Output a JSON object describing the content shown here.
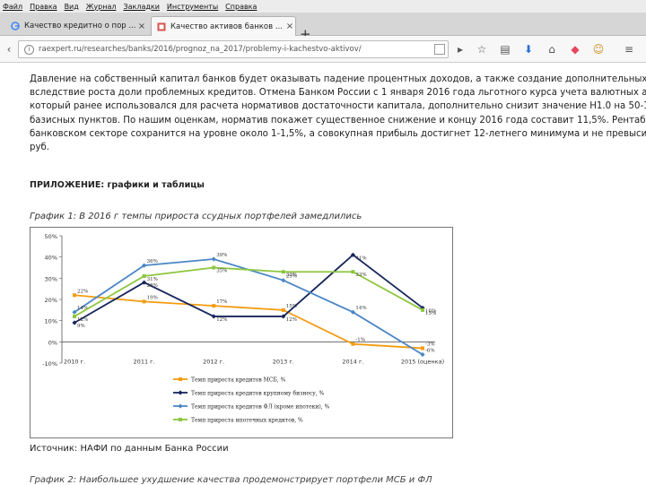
{
  "menubar": {
    "items": [
      "Файл",
      "Правка",
      "Вид",
      "Журнал",
      "Закладки",
      "Инструменты",
      "Справка"
    ]
  },
  "tabs": [
    {
      "title": "Качество кредитно о пор ...",
      "active": false,
      "favicon": "google-g-icon"
    },
    {
      "title": "Качество активов банков ...",
      "active": true,
      "favicon": "site-favicon-icon"
    }
  ],
  "toolbar": {
    "new_tab": "+",
    "url": "raexpert.ru/researches/banks/2016/prognoz_na_2017/problemy-i-kachestvo-aktivov/",
    "icons": [
      "star-icon",
      "clipboard-icon",
      "download-icon",
      "home-icon",
      "pocket-icon",
      "smiley-icon",
      "menu-icon"
    ]
  },
  "article": {
    "paragraph_lines": [
      "Давление на собственный капитал банков будет оказывать падение процентных доходов, а также создание дополнительных резервов",
      "вследствие роста доли проблемных кредитов. Отмена Банком России с 1 января 2016 года льготного курса учета валютных активов,",
      "который ранее использовался для расчета нормативов достаточности капитала, дополнительно снизит значение Н1.0 на 50-100",
      "базисных пунктов. По нашим оценкам, норматив покажет существенное снижение и концу 2016 года составит 11,5%. Рентабельность в",
      "банковском секторе сохранится на уровне около 1-1,5%, а совокупная прибыль достигнет 12-летнего минимума и не превысит 150 млрд",
      "руб."
    ],
    "appendix_heading": "ПРИЛОЖЕНИЕ: графики и таблицы",
    "chart_caption": "График 1: В 2016 г темпы прироста ссудных портфелей замедлились",
    "source": "Источник: НАФИ по данным Банка России",
    "next_caption": "График 2: Наибольшее ухудшение качества продемонстрирует портфели МСБ и ФЛ"
  },
  "chart_data": {
    "type": "line",
    "categories": [
      "2010 г.",
      "2011 г.",
      "2012 г.",
      "2013 г.",
      "2014 г.",
      "2015 (оценка)"
    ],
    "ylim": [
      -10,
      50
    ],
    "yticks": [
      "-10%",
      "0%",
      "10%",
      "20%",
      "30%",
      "40%",
      "50%"
    ],
    "series": [
      {
        "name": "Темп прироста кредитов МСБ, %",
        "color": "#f39c12",
        "marker": "square",
        "values": [
          22,
          19,
          17,
          15,
          -1,
          -3
        ],
        "labels": [
          "22%",
          "19%",
          "17%",
          "15%",
          "-1%",
          "-3%"
        ]
      },
      {
        "name": "Темп прироста кредитов крупному бизнесу, %",
        "color": "#17265c",
        "marker": "diamond",
        "values": [
          9,
          28,
          12,
          12,
          41,
          16
        ],
        "labels": [
          "9%",
          "28%",
          "12%",
          "12%",
          "41%",
          "16%"
        ]
      },
      {
        "name": "Темп прироста кредитов ФЛ (кроме ипотеки), %",
        "color": "#4a86c5",
        "marker": "diamond",
        "values": [
          14,
          36,
          39,
          29,
          14,
          -6
        ],
        "labels": [
          "14%",
          "36%",
          "39%",
          "29%",
          "14%",
          "-6%"
        ]
      },
      {
        "name": "Темп прироста ипотечных кредитов, %",
        "color": "#8dc63f",
        "marker": "square",
        "values": [
          12,
          31,
          35,
          33,
          33,
          15
        ],
        "labels": [
          "12%",
          "31%",
          "35%",
          "33%",
          "33%",
          "15%"
        ]
      }
    ],
    "grid": false,
    "legend_position": "bottom"
  }
}
